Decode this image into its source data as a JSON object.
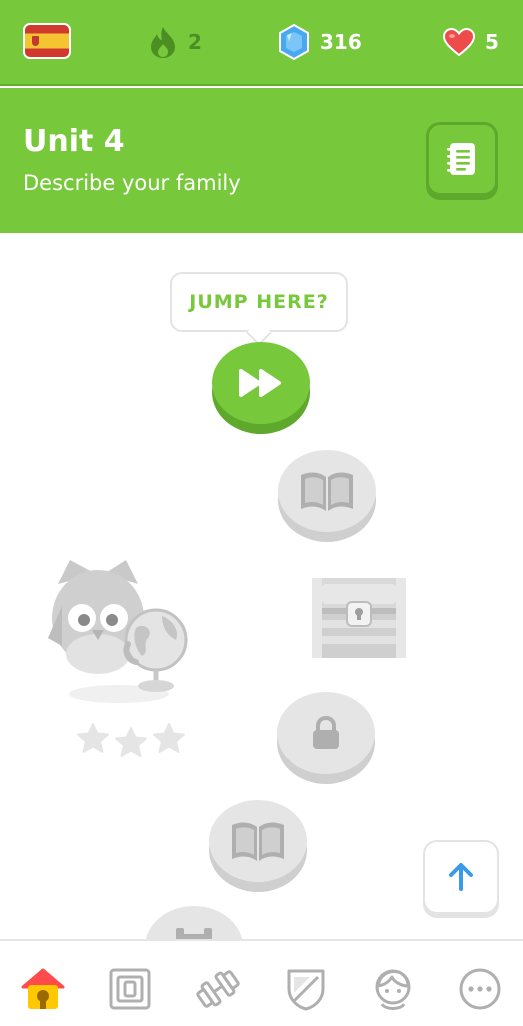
{
  "topbar": {
    "flag_icon": "spain-flag-icon",
    "streak": {
      "icon": "fire-icon",
      "count": "2",
      "color": "#4b8f23"
    },
    "gems": {
      "icon": "gem-icon",
      "count": "316",
      "color": "#48a9f0"
    },
    "hearts": {
      "icon": "heart-icon",
      "count": "5",
      "color": "#ee4b4b"
    }
  },
  "unit": {
    "title": "Unit 4",
    "subtitle": "Describe your family",
    "guide_icon": "guidebook-icon",
    "color": "#78c83c"
  },
  "path": {
    "jump_label": "JUMP HERE?",
    "nodes": [
      {
        "icon": "fast-forward-icon",
        "state": "jump"
      },
      {
        "icon": "book-icon",
        "state": "locked"
      },
      {
        "icon": "treasure-chest-icon",
        "state": "locked"
      },
      {
        "icon": "lock-icon",
        "state": "locked"
      },
      {
        "icon": "book-icon",
        "state": "locked"
      },
      {
        "icon": "dumbbell-icon",
        "state": "locked"
      }
    ],
    "mascot_icon": "owl-with-globe-icon",
    "stars": 3
  },
  "scroll_up_icon": "arrow-up-icon",
  "bottom_nav": [
    {
      "icon": "home-icon",
      "active": true
    },
    {
      "icon": "alphabet-icon",
      "active": false
    },
    {
      "icon": "practice-dumbbell-icon",
      "active": false
    },
    {
      "icon": "leagues-shield-icon",
      "active": false
    },
    {
      "icon": "profile-icon",
      "active": false
    },
    {
      "icon": "more-icon",
      "active": false
    }
  ]
}
